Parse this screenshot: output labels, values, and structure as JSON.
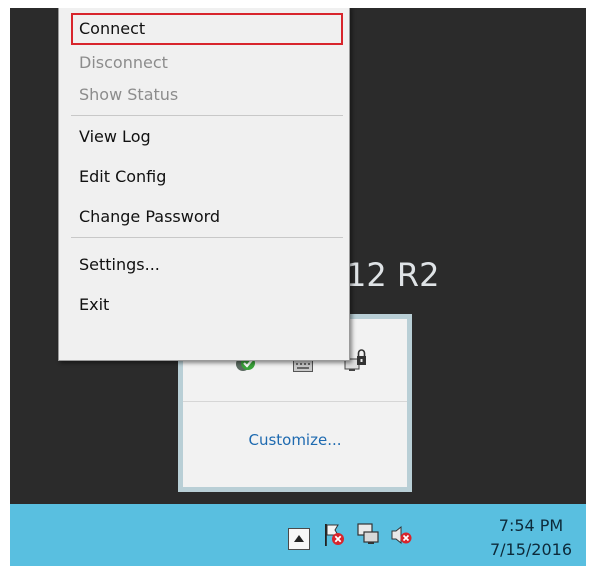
{
  "desktop": {
    "os_label": "12 R2"
  },
  "context_menu": {
    "items": [
      {
        "label": "Connect",
        "enabled": true,
        "highlighted": true
      },
      {
        "label": "Disconnect",
        "enabled": false
      },
      {
        "label": "Show Status",
        "enabled": false
      },
      {
        "label": "View Log",
        "enabled": true
      },
      {
        "label": "Edit Config",
        "enabled": true
      },
      {
        "label": "Change Password",
        "enabled": true
      },
      {
        "label": "Settings...",
        "enabled": true
      },
      {
        "label": "Exit",
        "enabled": true
      }
    ]
  },
  "tray_flyout": {
    "icons": [
      "shield-check-icon",
      "keyboard-icon",
      "vpn-lock-icon"
    ],
    "customize_label": "Customize..."
  },
  "taskbar": {
    "tray_icons": [
      "show-hidden-icons-arrow",
      "action-center-flag-error-icon",
      "network-icon",
      "volume-muted-icon"
    ],
    "clock": {
      "time": "7:54 PM",
      "date": "7/15/2016"
    }
  },
  "colors": {
    "desktop": "#2b2b2b",
    "taskbar": "#59bfe0",
    "highlight_border": "#d8252c",
    "link": "#1e6ab0"
  }
}
